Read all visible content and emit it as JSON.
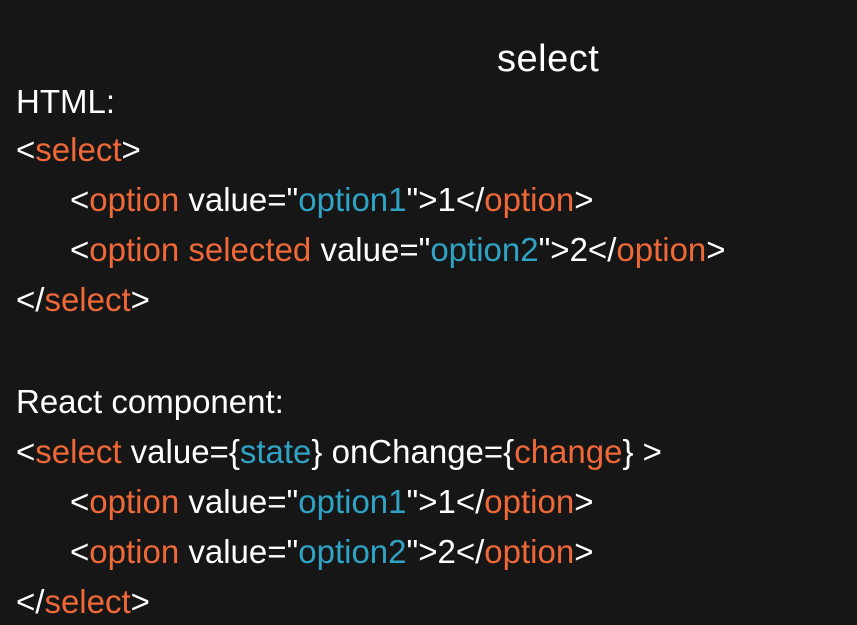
{
  "slide": {
    "title": "select",
    "colors": {
      "background": "#161616",
      "text": "#ffffff",
      "tag": "#ee6838",
      "string": "#2fa3c4"
    },
    "html_section": {
      "heading": "HTML:",
      "lines": [
        [
          {
            "t": "<",
            "c": "w"
          },
          {
            "t": "select",
            "c": "o"
          },
          {
            "t": ">",
            "c": "w"
          }
        ],
        [
          {
            "t": "<",
            "c": "w"
          },
          {
            "t": "option",
            "c": "o"
          },
          {
            "t": " value=\"",
            "c": "w"
          },
          {
            "t": "option1",
            "c": "b"
          },
          {
            "t": "\">1</",
            "c": "w"
          },
          {
            "t": "option",
            "c": "o"
          },
          {
            "t": ">",
            "c": "w"
          }
        ],
        [
          {
            "t": "<",
            "c": "w"
          },
          {
            "t": "option selected",
            "c": "o"
          },
          {
            "t": " value=\"",
            "c": "w"
          },
          {
            "t": "option2",
            "c": "b"
          },
          {
            "t": "\">2</",
            "c": "w"
          },
          {
            "t": "option",
            "c": "o"
          },
          {
            "t": ">",
            "c": "w"
          }
        ],
        [
          {
            "t": "</",
            "c": "w"
          },
          {
            "t": "select",
            "c": "o"
          },
          {
            "t": ">",
            "c": "w"
          }
        ]
      ]
    },
    "react_section": {
      "heading": "React component:",
      "lines": [
        [
          {
            "t": "<",
            "c": "w"
          },
          {
            "t": "select",
            "c": "o"
          },
          {
            "t": " value={",
            "c": "w"
          },
          {
            "t": "state",
            "c": "b"
          },
          {
            "t": "} onChange={",
            "c": "w"
          },
          {
            "t": "change",
            "c": "o"
          },
          {
            "t": "} >",
            "c": "w"
          }
        ],
        [
          {
            "t": "<",
            "c": "w"
          },
          {
            "t": "option",
            "c": "o"
          },
          {
            "t": " value=\"",
            "c": "w"
          },
          {
            "t": "option1",
            "c": "b"
          },
          {
            "t": "\">1</",
            "c": "w"
          },
          {
            "t": "option",
            "c": "o"
          },
          {
            "t": ">",
            "c": "w"
          }
        ],
        [
          {
            "t": "<",
            "c": "w"
          },
          {
            "t": "option",
            "c": "o"
          },
          {
            "t": " value=\"",
            "c": "w"
          },
          {
            "t": "option2",
            "c": "b"
          },
          {
            "t": "\">2</",
            "c": "w"
          },
          {
            "t": "option",
            "c": "o"
          },
          {
            "t": ">",
            "c": "w"
          }
        ],
        [
          {
            "t": "</",
            "c": "w"
          },
          {
            "t": "select",
            "c": "o"
          },
          {
            "t": ">",
            "c": "w"
          }
        ]
      ]
    }
  }
}
